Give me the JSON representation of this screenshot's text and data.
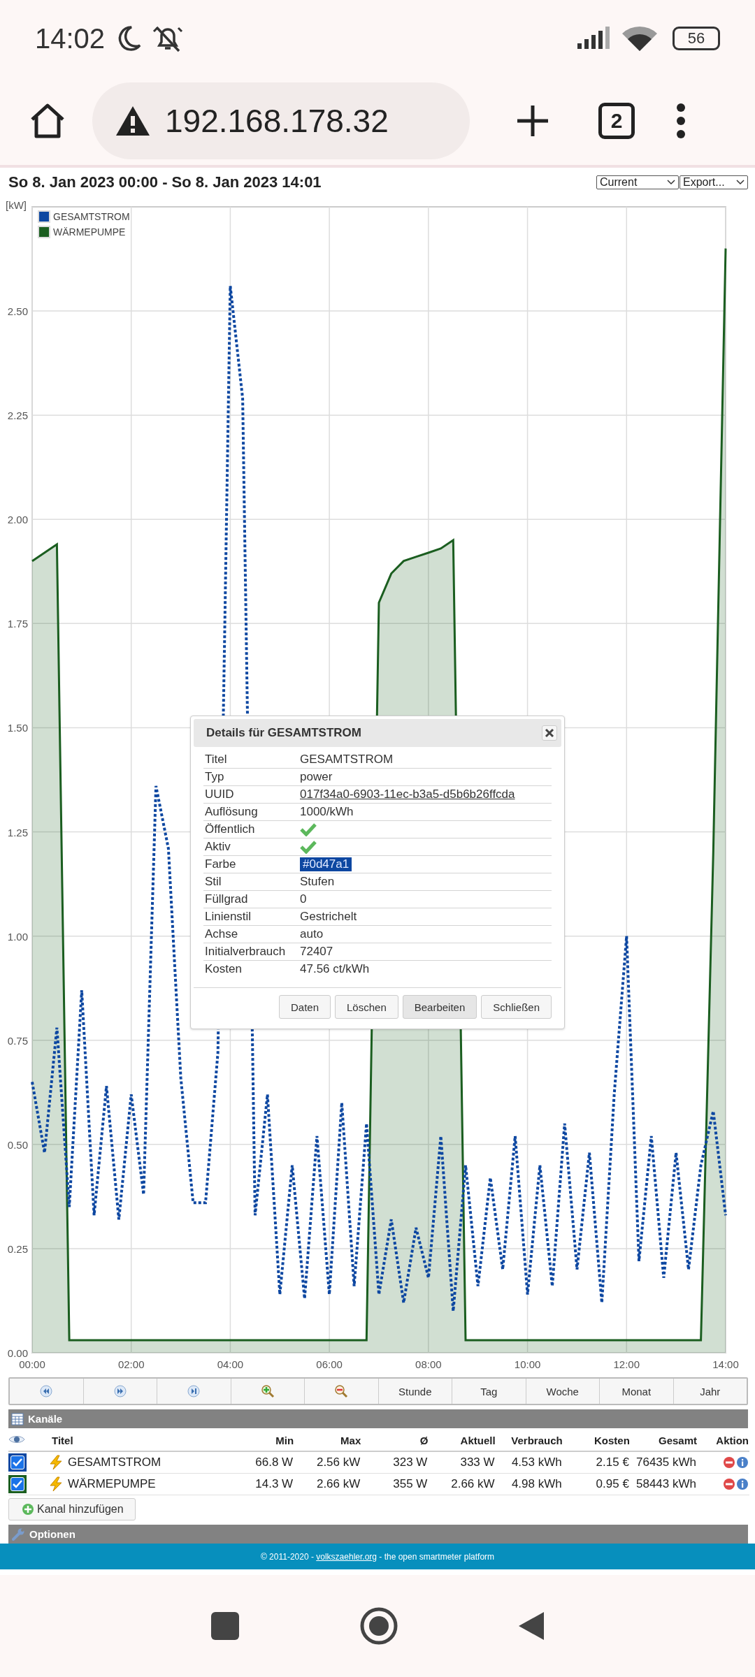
{
  "status_bar": {
    "time": "14:02",
    "battery": "56"
  },
  "browser": {
    "url": "192.168.178.32",
    "tab_count": "2"
  },
  "header": {
    "title": "So 8. Jan 2023 00:00 - So 8. Jan 2023 14:01",
    "selects": [
      {
        "value": "Current"
      },
      {
        "value": "Export..."
      }
    ]
  },
  "chart": {
    "unit": "[kW]",
    "chart_data": {
      "type": "line",
      "x": [
        0,
        0.25,
        0.5,
        0.75,
        1,
        1.25,
        1.5,
        1.75,
        2,
        2.25,
        2.5,
        2.75,
        3,
        3.25,
        3.5,
        3.75,
        4,
        4.25,
        4.5,
        4.75,
        5,
        5.25,
        5.5,
        5.75,
        6,
        6.25,
        6.5,
        6.75,
        7,
        7.25,
        7.5,
        7.75,
        8,
        8.25,
        8.5,
        8.75,
        9,
        9.25,
        9.5,
        9.75,
        10,
        10.25,
        10.5,
        10.75,
        11,
        11.25,
        11.5,
        11.75,
        12,
        12.25,
        12.5,
        12.75,
        13,
        13.25,
        13.5,
        13.75,
        14
      ],
      "xlim": [
        0,
        14
      ],
      "ylim": [
        0,
        2.75
      ],
      "grid": true,
      "legend": true,
      "xticks": [
        {
          "value": 0,
          "label": "00:00"
        },
        {
          "value": 2,
          "label": "02:00"
        },
        {
          "value": 4,
          "label": "04:00"
        },
        {
          "value": 6,
          "label": "06:00"
        },
        {
          "value": 8,
          "label": "08:00"
        },
        {
          "value": 10,
          "label": "10:00"
        },
        {
          "value": 12,
          "label": "12:00"
        },
        {
          "value": 14,
          "label": "14:00"
        }
      ],
      "yticks": [
        {
          "value": 0,
          "label": "0.00"
        },
        {
          "value": 0.25,
          "label": "0.25"
        },
        {
          "value": 0.5,
          "label": "0.50"
        },
        {
          "value": 0.75,
          "label": "0.75"
        },
        {
          "value": 1,
          "label": "1.00"
        },
        {
          "value": 1.25,
          "label": "1.25"
        },
        {
          "value": 1.5,
          "label": "1.50"
        },
        {
          "value": 1.75,
          "label": "1.75"
        },
        {
          "value": 2,
          "label": "2.00"
        },
        {
          "value": 2.25,
          "label": "2.25"
        },
        {
          "value": 2.5,
          "label": "2.50"
        }
      ],
      "series": [
        {
          "name": "GESAMTSTROM",
          "color": "#0d47a1",
          "type": "line",
          "line_style": "dashed",
          "values": [
            0.65,
            0.48,
            0.78,
            0.35,
            0.87,
            0.33,
            0.64,
            0.32,
            0.62,
            0.38,
            1.36,
            1.21,
            0.66,
            0.36,
            0.36,
            0.72,
            2.56,
            2.29,
            0.33,
            0.62,
            0.14,
            0.45,
            0.13,
            0.52,
            0.14,
            0.6,
            0.16,
            0.55,
            0.14,
            0.32,
            0.12,
            0.3,
            0.18,
            0.52,
            0.1,
            0.45,
            0.16,
            0.42,
            0.2,
            0.52,
            0.14,
            0.45,
            0.16,
            0.55,
            0.2,
            0.48,
            0.12,
            0.62,
            1.0,
            0.22,
            0.52,
            0.18,
            0.48,
            0.2,
            0.45,
            0.58,
            0.33
          ]
        },
        {
          "name": "WÄRMEPUMPE",
          "color": "#1b5e20",
          "type": "area",
          "line_style": "solid",
          "values": [
            1.9,
            1.92,
            1.94,
            0.03,
            0.03,
            0.03,
            0.03,
            0.03,
            0.03,
            0.03,
            0.03,
            0.03,
            0.03,
            0.03,
            0.03,
            0.03,
            0.03,
            0.03,
            0.03,
            0.03,
            0.03,
            0.03,
            0.03,
            0.03,
            0.03,
            0.03,
            0.03,
            0.03,
            1.8,
            1.87,
            1.9,
            1.91,
            1.92,
            1.93,
            1.95,
            0.03,
            0.03,
            0.03,
            0.03,
            0.03,
            0.03,
            0.03,
            0.03,
            0.03,
            0.03,
            0.03,
            0.03,
            0.03,
            0.03,
            0.03,
            0.03,
            0.03,
            0.03,
            0.03,
            0.03,
            1.2,
            2.65
          ]
        }
      ]
    }
  },
  "dialog": {
    "title": "Details für GESAMTSTROM",
    "rows": [
      {
        "label": "Titel",
        "kind": "text",
        "value": "GESAMTSTROM"
      },
      {
        "label": "Typ",
        "kind": "text",
        "value": "power"
      },
      {
        "label": "UUID",
        "kind": "link",
        "value": "017f34a0-6903-11ec-b3a5-d5b6b26ffcda"
      },
      {
        "label": "Auflösung",
        "kind": "text",
        "value": "1000/kWh"
      },
      {
        "label": "Öffentlich",
        "kind": "check",
        "checked": true
      },
      {
        "label": "Aktiv",
        "kind": "check",
        "checked": true
      },
      {
        "label": "Farbe",
        "kind": "color",
        "value": "#0d47a1",
        "color": "#0d47a1"
      },
      {
        "label": "Stil",
        "kind": "text",
        "value": "Stufen"
      },
      {
        "label": "Füllgrad",
        "kind": "text",
        "value": "0"
      },
      {
        "label": "Linienstil",
        "kind": "text",
        "value": "Gestrichelt"
      },
      {
        "label": "Achse",
        "kind": "text",
        "value": "auto"
      },
      {
        "label": "Initialverbrauch",
        "kind": "text",
        "value": "72407"
      },
      {
        "label": "Kosten",
        "kind": "text",
        "value": "47.56 ct/kWh"
      }
    ],
    "buttons": [
      {
        "label": "Daten",
        "focused": false
      },
      {
        "label": "Löschen",
        "focused": false
      },
      {
        "label": "Bearbeiten",
        "focused": true
      },
      {
        "label": "Schließen",
        "focused": false
      }
    ]
  },
  "toolbar": {
    "buttons": [
      "Stunde",
      "Tag",
      "Woche",
      "Monat",
      "Jahr"
    ]
  },
  "channels": {
    "title": "Kanäle",
    "columns": [
      "Titel",
      "Min",
      "Max",
      "Ø",
      "Aktuell",
      "Verbrauch",
      "Kosten",
      "Gesamt",
      "Aktion"
    ],
    "rows": [
      {
        "checked": true,
        "color": "#0d47a1",
        "cells": [
          "GESAMTSTROM",
          "66.8 W",
          "2.56 kW",
          "323 W",
          "333 W",
          "4.53 kWh",
          "2.15 €",
          "76435 kWh"
        ]
      },
      {
        "checked": true,
        "color": "#1b5e20",
        "cells": [
          "WÄRMEPUMPE",
          "14.3 W",
          "2.66 kW",
          "355 W",
          "2.66 kW",
          "4.98 kWh",
          "0.95 €",
          "58443 kWh"
        ]
      }
    ],
    "add_button": "Kanal hinzufügen"
  },
  "options": {
    "title": "Optionen"
  },
  "footer": {
    "prefix": "© 2011-2020 - ",
    "link": "volkszaehler.org",
    "suffix": " - the open smartmeter platform"
  }
}
